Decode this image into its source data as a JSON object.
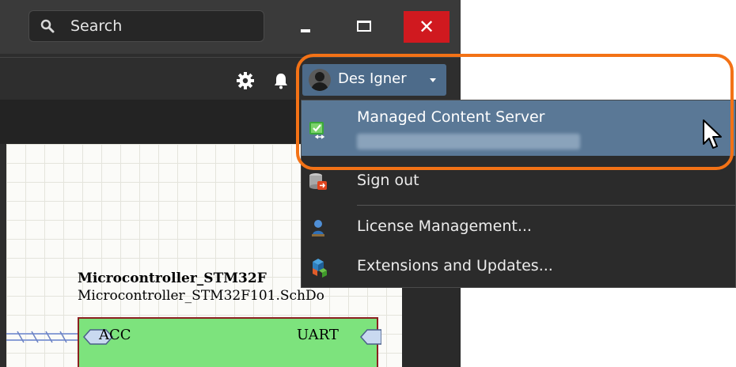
{
  "search": {
    "label": "Search"
  },
  "window_controls": {
    "minimize": "minimize",
    "maximize": "maximize",
    "close_glyph": "✕"
  },
  "toolbar": {
    "settings_icon": "gear-icon",
    "notifications_icon": "bell-icon",
    "user": {
      "name": "Des Igner",
      "avatar_icon": "avatar-icon"
    }
  },
  "user_menu": {
    "items": [
      {
        "label": "Managed Content Server",
        "icon": "server-connected-icon",
        "subtitle_blurred": true
      },
      {
        "label": "Sign out",
        "icon": "sign-out-icon"
      },
      {
        "label": "License Management...",
        "icon": "license-icon"
      },
      {
        "label": "Extensions and Updates...",
        "icon": "extensions-icon"
      }
    ]
  },
  "schematic": {
    "component_title": "Microcontroller_STM32F",
    "component_file": "Microcontroller_STM32F101.SchDo",
    "pins": {
      "left": "ACC",
      "right": "UART"
    }
  },
  "colors": {
    "highlight": "#f37216",
    "menu_selected": "#5a7896",
    "user_button": "#4d6b8a",
    "close_button": "#d0191f",
    "component_fill": "#7de37d"
  }
}
